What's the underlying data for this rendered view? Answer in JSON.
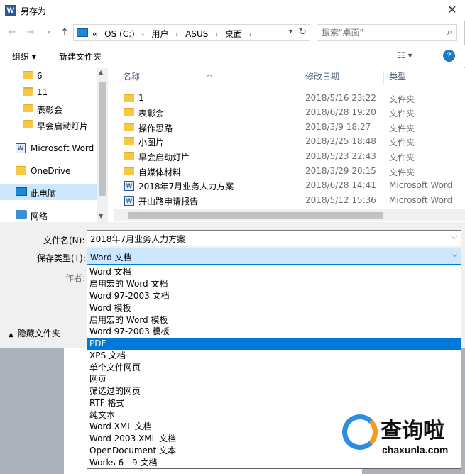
{
  "window": {
    "title": "另存为",
    "app_icon": "W",
    "close_glyph": "✕"
  },
  "address": {
    "crumbs": [
      "«",
      "OS (C:)",
      "›",
      "用户",
      "›",
      "ASUS",
      "›",
      "桌面",
      "›"
    ],
    "search_placeholder": "搜索\"桌面\""
  },
  "toolbar": {
    "organize_label": "组织 ▾",
    "new_folder_label": "新建文件夹",
    "help_glyph": "?"
  },
  "nav_pane": {
    "items": [
      {
        "label": "6",
        "icon": "folder-icon"
      },
      {
        "label": "11",
        "icon": "folder-icon"
      },
      {
        "label": "表彰会",
        "icon": "folder-icon"
      },
      {
        "label": "早会启动灯片",
        "icon": "folder-icon"
      },
      {
        "label": "Microsoft Word",
        "icon": "word-icon"
      },
      {
        "label": "OneDrive",
        "icon": "folder-icon"
      },
      {
        "label": "此电脑",
        "icon": "computer-icon"
      },
      {
        "label": "网络",
        "icon": "network-icon"
      }
    ]
  },
  "file_list": {
    "headers": {
      "name": "名称",
      "date": "修改日期",
      "type": "类型"
    },
    "rows": [
      {
        "name": "1",
        "date": "2018/5/16 23:22",
        "type": "文件夹",
        "icon": "folder-icon"
      },
      {
        "name": "表彰会",
        "date": "2018/6/28 19:20",
        "type": "文件夹",
        "icon": "folder-icon"
      },
      {
        "name": "操作思路",
        "date": "2018/3/9 18:27",
        "type": "文件夹",
        "icon": "folder-icon"
      },
      {
        "name": "小图片",
        "date": "2018/2/25 18:48",
        "type": "文件夹",
        "icon": "folder-icon"
      },
      {
        "name": "早会启动灯片",
        "date": "2018/5/23 22:43",
        "type": "文件夹",
        "icon": "folder-icon"
      },
      {
        "name": "自媒体材料",
        "date": "2018/3/29 20:15",
        "type": "文件夹",
        "icon": "folder-icon"
      },
      {
        "name": "2018年7月业务人力方案",
        "date": "2018/6/28 14:41",
        "type": "Microsoft Word",
        "icon": "word-icon"
      },
      {
        "name": "开山路申请报告",
        "date": "2018/5/12 15:36",
        "type": "Microsoft Word",
        "icon": "word-icon"
      }
    ]
  },
  "form": {
    "filename_label": "文件名(N):",
    "filename_value": "2018年7月业务人力方案",
    "savetype_label": "保存类型(T):",
    "savetype_value": "Word 文档",
    "author_label": "作者:",
    "hide_folders_label": "隐藏文件夹"
  },
  "savetype_options": {
    "selected_index": 6,
    "items": [
      "Word 文档",
      "启用宏的 Word 文档",
      "Word 97-2003 文档",
      "Word 模板",
      "启用宏的 Word 模板",
      "Word 97-2003 模板",
      "PDF",
      "XPS 文档",
      "单个文件网页",
      "网页",
      "筛选过的网页",
      "RTF 格式",
      "纯文本",
      "Word XML 文档",
      "Word 2003 XML 文档",
      "OpenDocument 文本",
      "Works 6 - 9 文档"
    ]
  },
  "watermark": {
    "brand": "查询啦",
    "url": "chaxunla.com"
  },
  "colors": {
    "accent": "#0078d7",
    "selection_bg": "#cce8ff",
    "folder": "#f7c843"
  }
}
